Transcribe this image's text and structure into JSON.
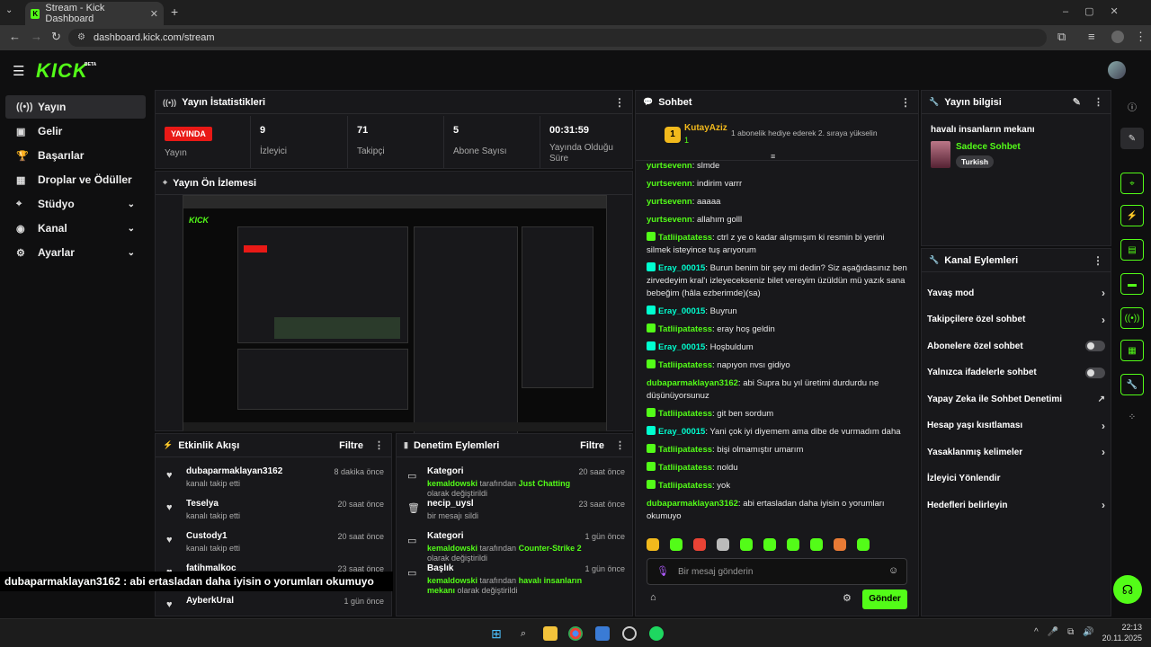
{
  "browser": {
    "tab_title": "Stream - Kick Dashboard",
    "url": "dashboard.kick.com/stream"
  },
  "app": {
    "logo": "KICK",
    "beta": "BETA"
  },
  "sidebar": {
    "items": [
      {
        "label": "Yayın",
        "icon": "live-icon",
        "active": true
      },
      {
        "label": "Gelir",
        "icon": "revenue-icon"
      },
      {
        "label": "Başarılar",
        "icon": "trophy-icon"
      },
      {
        "label": "Droplar ve Ödüller",
        "icon": "gift-icon"
      },
      {
        "label": "Stüdyo",
        "icon": "studio-icon",
        "expandable": true
      },
      {
        "label": "Kanal",
        "icon": "channel-icon",
        "expandable": true
      },
      {
        "label": "Ayarlar",
        "icon": "gear-icon",
        "expandable": true
      }
    ]
  },
  "stats": {
    "title": "Yayın İstatistikleri",
    "status_badge": "YAYINDA",
    "status_label": "Yayın",
    "viewers_value": "9",
    "viewers_label": "İzleyici",
    "followers_value": "71",
    "followers_label": "Takipçi",
    "subs_value": "5",
    "subs_label": "Abone Sayısı",
    "uptime_value": "00:31:59",
    "uptime_label": "Yayında Olduğu Süre"
  },
  "preview": {
    "title": "Yayın Ön İzlemesi"
  },
  "activity": {
    "title": "Etkinlik Akışı",
    "filter": "Filtre",
    "items": [
      {
        "name": "dubaparmaklayan3162",
        "sub": "kanalı takip etti",
        "time": "8 dakika önce"
      },
      {
        "name": "Teselya",
        "sub": "kanalı takip etti",
        "time": "20 saat önce"
      },
      {
        "name": "Custody1",
        "sub": "kanalı takip etti",
        "time": "20 saat önce"
      },
      {
        "name": "fatihmalkoc",
        "sub": "",
        "time": "23 saat önce"
      },
      {
        "name": "AyberkUral",
        "sub": "",
        "time": "1 gün önce"
      }
    ]
  },
  "moderation": {
    "title": "Denetim Eylemleri",
    "filter": "Filtre",
    "items": [
      {
        "name": "Kategori",
        "actor": "kemaldowski",
        "mid": " tarafından ",
        "target": "Just Chatting",
        "tail": " olarak değiştirildi",
        "time": "20 saat önce"
      },
      {
        "name": "necip_uysl",
        "plain": "bir mesajı sildi",
        "time": "23 saat önce"
      },
      {
        "name": "Kategori",
        "actor": "kemaldowski",
        "mid": " tarafından ",
        "target": "Counter-Strike 2",
        "tail": " olarak değiştirildi",
        "time": "1 gün önce"
      },
      {
        "name": "Başlık",
        "actor": "kemaldowski",
        "mid": " tarafından ",
        "target": "havalı insanların mekanı",
        "tail": " olarak değiştirildi",
        "time": "1 gün önce"
      }
    ]
  },
  "overlay_caption": "dubaparmaklayan3162 : abi ertasladan daha iyisin o yorumları okumuyo",
  "chat": {
    "title": "Sohbet",
    "pinned_user": "KutayAziz",
    "pinned_rank": "1",
    "pinned_sub": "1",
    "pinned_text": "1 abonelik hediye ederek 2. sıraya yükselin",
    "messages": [
      {
        "user": "yurtsevenn",
        "text": "slmde",
        "style": "u1"
      },
      {
        "user": "yurtsevenn",
        "text": "indirim varrr",
        "style": "u1"
      },
      {
        "user": "yurtsevenn",
        "text": "aaaaa",
        "style": "u1"
      },
      {
        "user": "yurtsevenn",
        "text": "allahım golll",
        "style": "u1"
      },
      {
        "user": "Tatliipatatess",
        "text": "ctrl z ye o kadar alışmışım ki resmin bi yerini silmek isteyince tuş arıyorum",
        "style": "u2",
        "badge": true
      },
      {
        "user": "Eray_00015",
        "text": "Burun benim bir şey mi dedin? Siz aşağıdasınız ben zirvedeyim kral'ı izleyecekseniz bilet vereyim üzüldün mü yazık sana bebeğim (hâla ezberimde)(sa)",
        "style": "u3",
        "badge": true
      },
      {
        "user": "Eray_00015",
        "text": "Buyrun",
        "style": "u3",
        "badge": true
      },
      {
        "user": "Tatliipatatess",
        "text": "eray hoş geldin",
        "style": "u2",
        "badge": true
      },
      {
        "user": "Eray_00015",
        "text": "Hoşbuldum",
        "style": "u3",
        "badge": true
      },
      {
        "user": "Tatliipatatess",
        "text": "napıyon nvsı gidiyo",
        "style": "u2",
        "badge": true
      },
      {
        "user": "dubaparmaklayan3162",
        "text": "abi Supra bu yıl üretimi durdurdu ne düşünüyorsunuz",
        "style": "u1"
      },
      {
        "user": "Tatliipatatess",
        "text": "git ben sordum",
        "style": "u2",
        "badge": true
      },
      {
        "user": "Eray_00015",
        "text": "Yani çok iyi diyemem ama dibe de vurmadım daha",
        "style": "u3",
        "badge": true
      },
      {
        "user": "Tatliipatatess",
        "text": "bişi olmamıştır umarım",
        "style": "u2",
        "badge": true
      },
      {
        "user": "Tatliipatatess",
        "text": "noldu",
        "style": "u2",
        "badge": true
      },
      {
        "user": "Tatliipatatess",
        "text": "yok",
        "style": "u2",
        "badge": true
      },
      {
        "user": "dubaparmaklayan3162",
        "text": "abi ertasladan daha iyisin o yorumları okumuyo",
        "style": "u1"
      }
    ],
    "input_placeholder": "Bir mesaj gönderin",
    "send_label": "Gönder"
  },
  "stream_info": {
    "title": "Yayın bilgisi",
    "stream_title": "havalı insanların mekanı",
    "category": "Sadece Sohbet",
    "tag": "Turkish"
  },
  "channel_actions": {
    "title": "Kanal Eylemleri",
    "items": [
      {
        "label": "Yavaş mod",
        "control": "chevron"
      },
      {
        "label": "Takipçilere özel sohbet",
        "control": "chevron"
      },
      {
        "label": "Abonelere özel sohbet",
        "control": "toggle"
      },
      {
        "label": "Yalnızca ifadelerle sohbet",
        "control": "toggle"
      },
      {
        "label": "Yapay Zeka ile Sohbet Denetimi",
        "control": "external"
      },
      {
        "label": "Hesap yaşı kısıtlaması",
        "control": "chevron"
      },
      {
        "label": "Yasaklanmış kelimeler",
        "control": "chevron"
      },
      {
        "label": "İzleyici Yönlendir",
        "control": "none"
      },
      {
        "label": "Hedefleri belirleyin",
        "control": "chevron"
      }
    ]
  },
  "taskbar": {
    "time": "22:13",
    "date": "20.11.2025"
  },
  "colors": {
    "brand": "#53fc18",
    "live": "#e91916",
    "panel": "#18181b"
  }
}
